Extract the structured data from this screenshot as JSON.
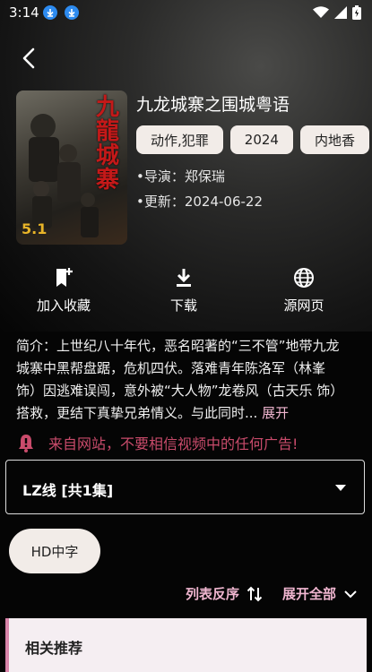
{
  "status": {
    "time": "3:14"
  },
  "movie": {
    "title": "九龙城寨之围城粤语",
    "tags": [
      "动作,犯罪",
      "2024",
      "内地香"
    ],
    "director": "•导演：郑保瑞",
    "updated": "•更新：2024-06-22",
    "poster": {
      "title_text": "九龍城寨",
      "date_text": "5.1"
    }
  },
  "actions": {
    "favorite": "加入收藏",
    "download": "下载",
    "source": "源网页"
  },
  "synopsis": {
    "text": "简介：上世纪八十年代，恶名昭著的“三不管”地带九龙城寨中黑帮盘踞，危机四伏。落难青年陈洛军（林峯 饰）因逃难误闯，意外被“大人物”龙卷风（古天乐 饰）搭救，更结下真挚兄弟情义。与此同时...",
    "expand": "展开"
  },
  "warning": {
    "text": "来自网站，不要相信视频中的任何广告!"
  },
  "line_select": {
    "label": "LZ线 [共1集]"
  },
  "episodes": [
    "HD中字"
  ],
  "list_controls": {
    "reverse": "列表反序",
    "expand_all": "展开全部"
  },
  "related": {
    "title": "相关推荐"
  },
  "colors": {
    "accent": "#f0b6d0",
    "warning": "#c94b6b",
    "chip_bg": "#f2ece8"
  }
}
